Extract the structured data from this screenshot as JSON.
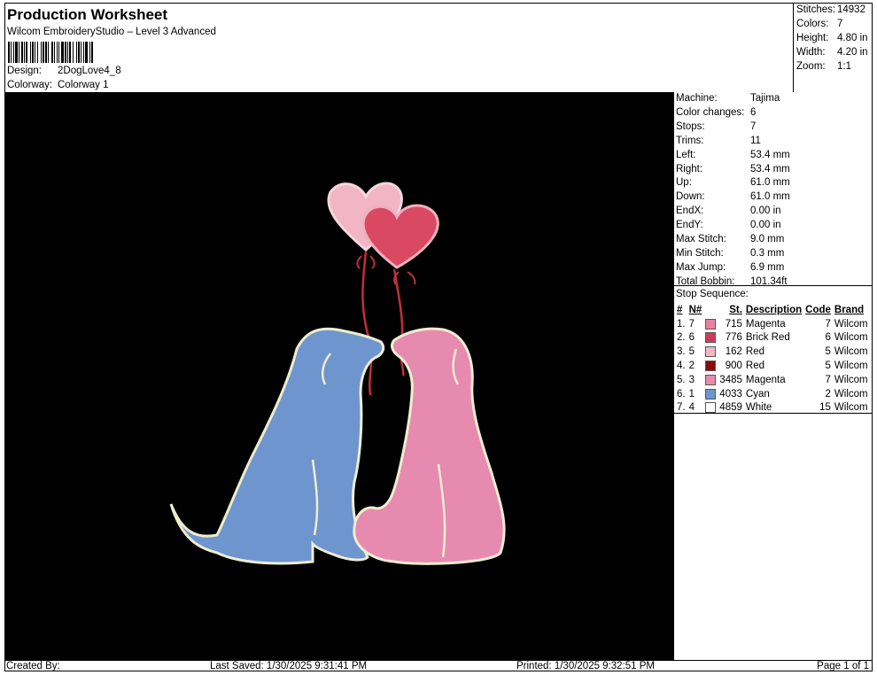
{
  "header": {
    "title": "Production Worksheet",
    "subtitle": "Wilcom EmbroideryStudio – Level 3 Advanced",
    "design_label": "Design:",
    "design_value": "2DogLove4_8",
    "colorway_label": "Colorway:",
    "colorway_value": "Colorway 1"
  },
  "stats": {
    "stitches_label": "Stitches:",
    "stitches": "14932",
    "colors_label": "Colors:",
    "colors": "7",
    "height_label": "Height:",
    "height": "4.80 in",
    "width_label": "Width:",
    "width": "4.20 in",
    "zoom_label": "Zoom:",
    "zoom": "1:1"
  },
  "machine": [
    {
      "k": "Machine:",
      "v": "Tajima"
    },
    {
      "k": "Color changes:",
      "v": "6"
    },
    {
      "k": "Stops:",
      "v": "7"
    },
    {
      "k": "Trims:",
      "v": "11"
    },
    {
      "k": "Left:",
      "v": "53.4 mm"
    },
    {
      "k": "Right:",
      "v": "53.4 mm"
    },
    {
      "k": "Up:",
      "v": "61.0 mm"
    },
    {
      "k": "Down:",
      "v": "61.0 mm"
    },
    {
      "k": "EndX:",
      "v": "0.00 in"
    },
    {
      "k": "EndY:",
      "v": "0.00 in"
    },
    {
      "k": "Max Stitch:",
      "v": "9.0 mm"
    },
    {
      "k": "Min Stitch:",
      "v": "0.3 mm"
    },
    {
      "k": "Max Jump:",
      "v": "6.9 mm"
    },
    {
      "k": "Total Bobbin:",
      "v": "101.34ft"
    }
  ],
  "sequence": {
    "title": "Stop Sequence:",
    "headers": [
      "#",
      "N#",
      "St.",
      "Description",
      "Code",
      "Brand"
    ],
    "rows": [
      {
        "num": "1.",
        "n": "7",
        "color": "#e8829e",
        "st": "715",
        "desc": "Magenta",
        "code": "7",
        "brand": "Wilcom"
      },
      {
        "num": "2.",
        "n": "6",
        "color": "#d33a55",
        "st": "776",
        "desc": "Brick Red",
        "code": "6",
        "brand": "Wilcom"
      },
      {
        "num": "3.",
        "n": "5",
        "color": "#f2b8c6",
        "st": "162",
        "desc": "Red",
        "code": "5",
        "brand": "Wilcom"
      },
      {
        "num": "4.",
        "n": "2",
        "color": "#8b0a0a",
        "st": "900",
        "desc": "Red",
        "code": "5",
        "brand": "Wilcom"
      },
      {
        "num": "5.",
        "n": "3",
        "color": "#e98ab1",
        "st": "3485",
        "desc": "Magenta",
        "code": "7",
        "brand": "Wilcom"
      },
      {
        "num": "6.",
        "n": "1",
        "color": "#6f95cf",
        "st": "4033",
        "desc": "Cyan",
        "code": "2",
        "brand": "Wilcom"
      },
      {
        "num": "7.",
        "n": "4",
        "color": "#ffffff",
        "st": "4859",
        "desc": "White",
        "code": "15",
        "brand": "Wilcom"
      }
    ]
  },
  "footer": {
    "created": "Created By:",
    "saved": "Last Saved: 1/30/2025 9:31:41 PM",
    "printed": "Printed: 1/30/2025 9:32:51 PM",
    "page": "Page 1 of 1"
  }
}
